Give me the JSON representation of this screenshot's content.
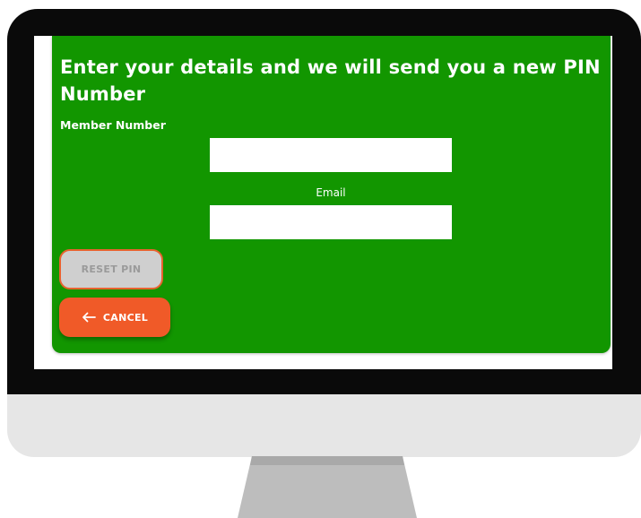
{
  "form": {
    "title": "Enter your details and we will send you a new PIN Number",
    "member_number_label": "Member Number",
    "member_number_value": "",
    "email_label": "Email",
    "email_value": ""
  },
  "actions": {
    "reset_label": "RESET PIN",
    "cancel_label": "CANCEL",
    "cancel_icon": "arrow-left-icon"
  },
  "colors": {
    "card_background": "#129600",
    "cancel_button": "#f05a28",
    "reset_button_disabled": "#cfcfcf",
    "reset_button_border": "#e8622e",
    "bezel": "#0a0a0a"
  }
}
